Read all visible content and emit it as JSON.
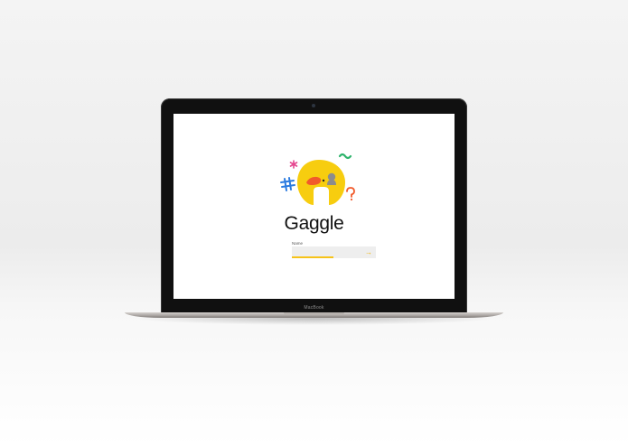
{
  "device": {
    "brand_label": "MacBook"
  },
  "app": {
    "title": "Gaggle",
    "logo_icon": "gaggle-logo-icon",
    "decorations": [
      "asterisk-icon",
      "hash-icon",
      "tilde-icon",
      "question-icon"
    ],
    "colors": {
      "brand_yellow": "#F7CD0F",
      "accent_red": "#F15A2B",
      "accent_pink": "#E5478F",
      "accent_blue": "#2B7BE0",
      "accent_green": "#2DB36B"
    }
  },
  "login": {
    "name_label": "Name",
    "name_value": "",
    "name_placeholder": "",
    "submit_icon": "arrow-right-icon",
    "submit_symbol": "→"
  }
}
